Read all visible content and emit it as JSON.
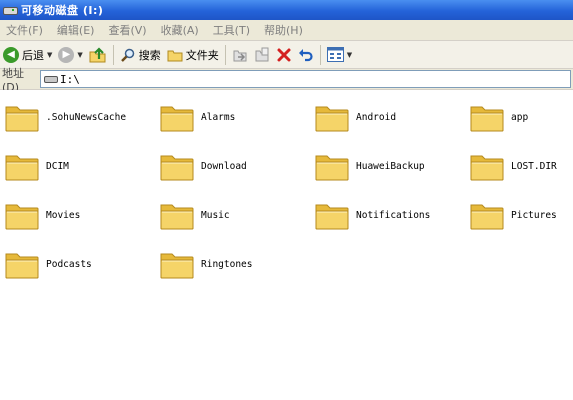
{
  "window": {
    "title": "可移动磁盘 (I:)"
  },
  "menubar": [
    {
      "name": "menu-file",
      "label": "文件(F)"
    },
    {
      "name": "menu-edit",
      "label": "编辑(E)"
    },
    {
      "name": "menu-view",
      "label": "查看(V)"
    },
    {
      "name": "menu-favorites",
      "label": "收藏(A)"
    },
    {
      "name": "menu-tools",
      "label": "工具(T)"
    },
    {
      "name": "menu-help",
      "label": "帮助(H)"
    }
  ],
  "toolbar": {
    "back_label": "后退",
    "search_label": "搜索",
    "folders_label": "文件夹"
  },
  "address": {
    "label": "地址(D)",
    "value": "I:\\"
  },
  "colors": {
    "folder_fill": "#f5d468",
    "folder_back": "#e6b93a",
    "title_bar": "#2463d9"
  },
  "folders": [
    {
      "name": ".SohuNewsCache"
    },
    {
      "name": "Alarms"
    },
    {
      "name": "Android"
    },
    {
      "name": "app"
    },
    {
      "name": "DCIM"
    },
    {
      "name": "Download"
    },
    {
      "name": "HuaweiBackup"
    },
    {
      "name": "LOST.DIR"
    },
    {
      "name": "Movies"
    },
    {
      "name": "Music"
    },
    {
      "name": "Notifications"
    },
    {
      "name": "Pictures"
    },
    {
      "name": "Podcasts"
    },
    {
      "name": "Ringtones"
    }
  ]
}
